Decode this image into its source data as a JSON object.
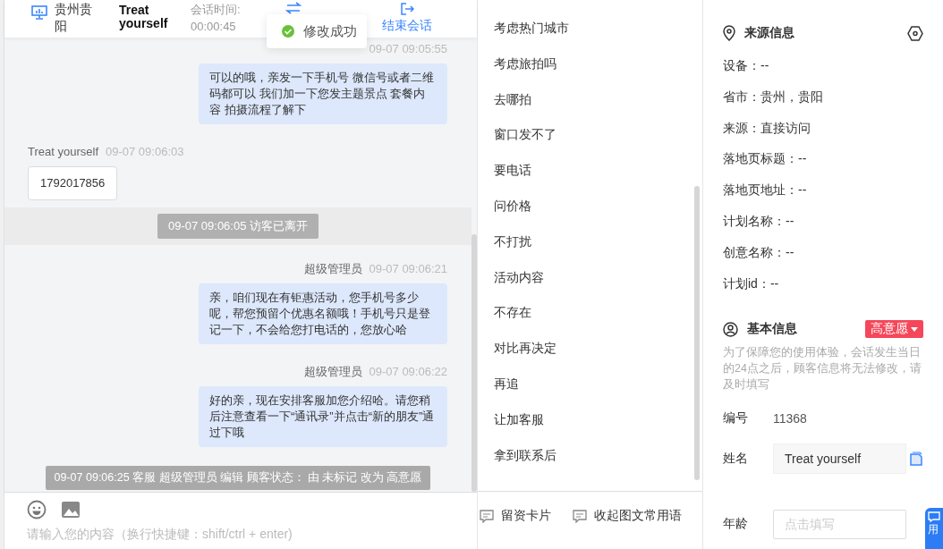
{
  "header": {
    "location": "贵州贵阳",
    "visitor": "Treat yourself",
    "session_label": "会话时间:",
    "session_time": "00:00:45",
    "end_button": "结束会话"
  },
  "toast": {
    "text": "修改成功"
  },
  "messages": [
    {
      "kind": "agent",
      "time": "09-07 09:05:55",
      "text": "可以的哦，亲发一下手机号 微信号或者二维码都可以 我们加一下您发主题景点 套餐内容 拍摄流程了解下"
    },
    {
      "kind": "visitor",
      "sender": "Treat yourself",
      "time": "09-07 09:06:03",
      "text": "1792017856"
    },
    {
      "kind": "band",
      "text": "09-07 09:06:05 访客已离开"
    },
    {
      "kind": "agent",
      "sender": "超级管理员",
      "time": "09-07 09:06:21",
      "text": "亲，咱们现在有钜惠活动，您手机号多少呢，帮您预留个优惠名额哦！手机号只是登记一下，不会给您打电话的，您放心哈"
    },
    {
      "kind": "agent",
      "sender": "超级管理员",
      "time": "09-07 09:06:22",
      "text": "好的亲，现在安排客服加您介绍哈。请您稍后注意查看一下“通讯录”并点击“新的朋友”通过下哦"
    },
    {
      "kind": "notice",
      "text": "09-07 09:06:25 客服 超级管理员 编辑 顾客状态： 由 未标记 改为 高意愿"
    }
  ],
  "composer": {
    "placeholder": "请输入您的内容（换行快捷键：shift/ctrl + enter)"
  },
  "phrases": [
    "考虑热门城市",
    "考虑旅拍吗",
    "去哪拍",
    "窗口发不了",
    "要电话",
    "问价格",
    "不打扰",
    "活动内容",
    "不存在",
    "对比再决定",
    "再追",
    "让加客服",
    "拿到联系后"
  ],
  "phrase_actions": [
    "留资卡片",
    "收起图文常用语"
  ],
  "source_info": {
    "title": "来源信息",
    "rows": [
      "设备：--",
      "省市：贵州，贵阳",
      "来源：直接访问",
      "落地页标题：--",
      "落地页地址：--",
      "计划名称：--",
      "创意名称：--",
      "计划id：--"
    ]
  },
  "basic_info": {
    "title": "基本信息",
    "status": {
      "label": "高意愿",
      "color": "#f5475a"
    },
    "note": "为了保障您的使用体验，会话发生当日的24点之后，顾客信息将无法修改，请及时填写",
    "fields": [
      {
        "kind": "text",
        "label": "编号",
        "value": "11368"
      },
      {
        "kind": "filled",
        "label": "姓名",
        "value": "Treat yourself"
      },
      {
        "kind": "input",
        "label": "年龄",
        "placeholder": "点击填写"
      }
    ]
  },
  "float_button": {
    "label": "用"
  }
}
